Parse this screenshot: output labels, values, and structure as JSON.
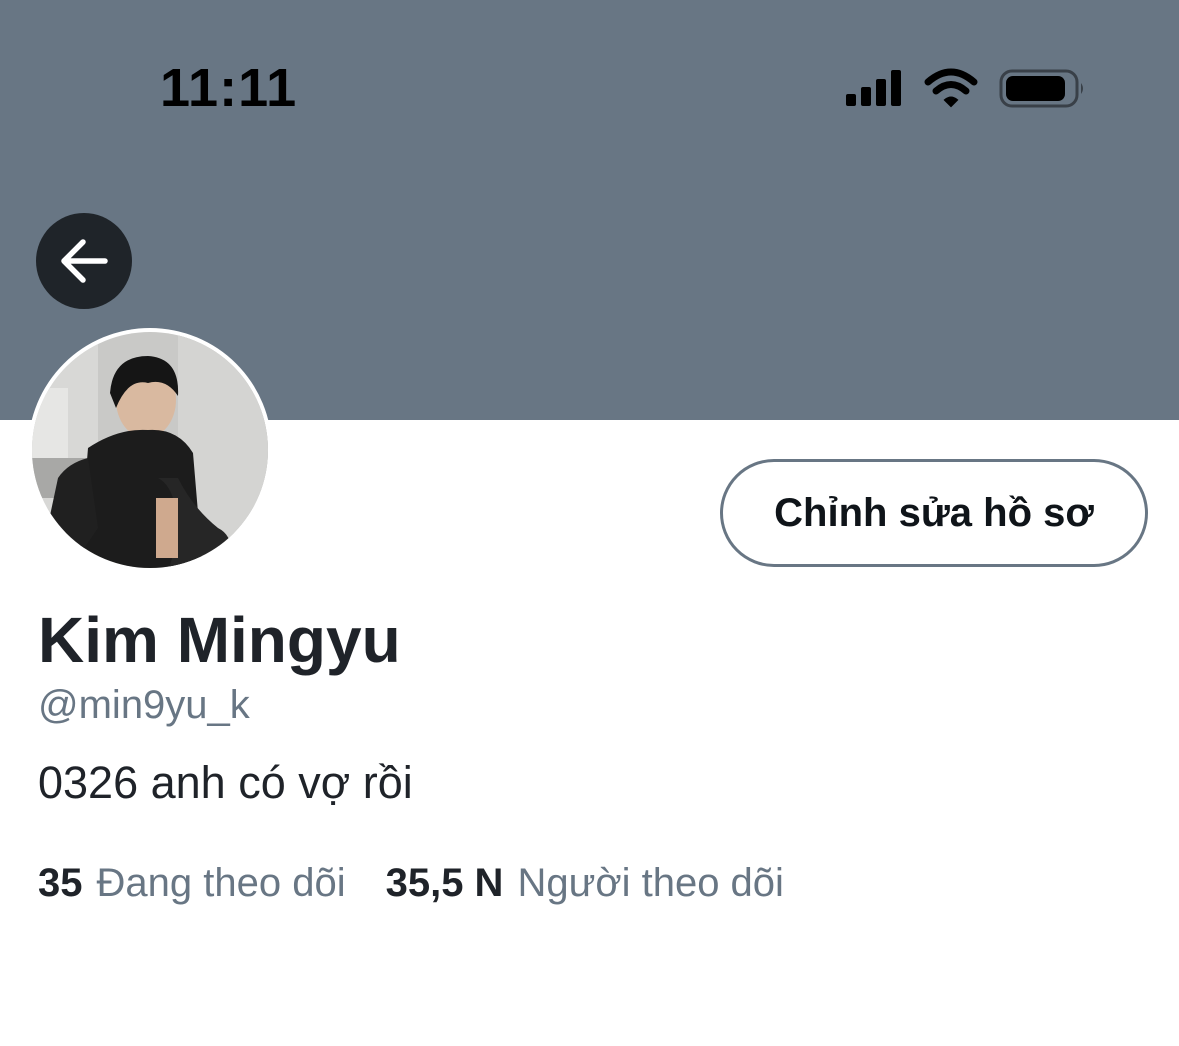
{
  "status_bar": {
    "time": "11:11",
    "icons": [
      "signal-icon",
      "wifi-icon",
      "battery-icon"
    ]
  },
  "header": {
    "banner_color": "#687684",
    "back_icon": "arrow-left-icon"
  },
  "profile": {
    "edit_button_label": "Chỉnh sửa hồ sơ",
    "display_name": "Kim Mingyu",
    "handle": "@min9yu_k",
    "bio": "0326 anh có vợ rồi",
    "following_count": "35",
    "following_label": "Đang theo dõi",
    "followers_count": "35,5 N",
    "followers_label": "Người theo dõi"
  },
  "colors": {
    "text_primary": "#1f2329",
    "text_secondary": "#687684",
    "back_button_bg": "#1f2429"
  }
}
